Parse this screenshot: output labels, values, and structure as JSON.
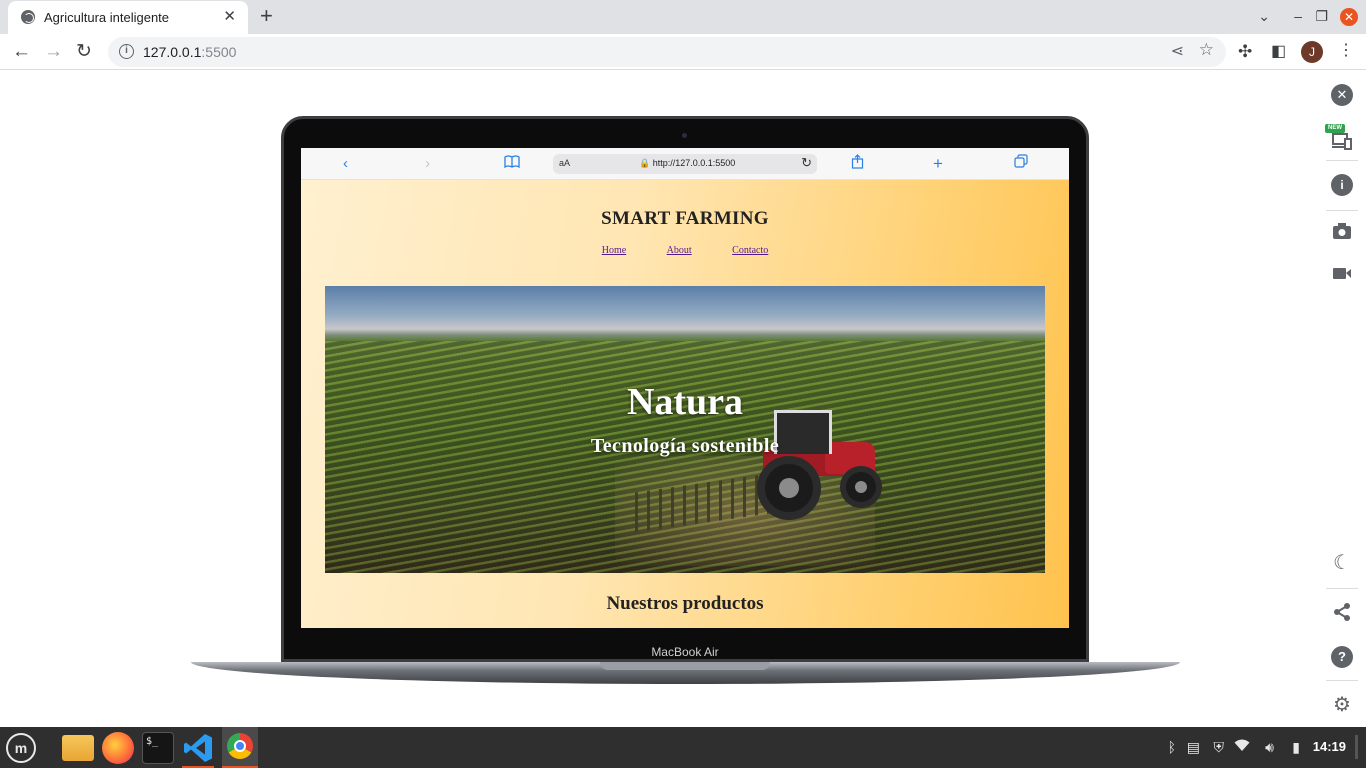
{
  "browser": {
    "tab": {
      "title": "Agricultura inteligente",
      "close_icon": "close-icon"
    },
    "window_controls": {
      "minimize": "–",
      "restore": "❐",
      "close": "✕",
      "tab_list": "⌄"
    },
    "toolbar": {
      "url_host": "127.0.0.1",
      "url_port": ":5500",
      "profile_initial": "J"
    }
  },
  "macbook": {
    "brand_label": "MacBook Air",
    "safari": {
      "aa_label": "aA",
      "url": "http://127.0.0.1:5500"
    }
  },
  "site": {
    "title": "SMART FARMING",
    "nav": [
      "Home",
      "About",
      "Contacto"
    ],
    "hero": {
      "title": "Natura",
      "subtitle": "Tecnología sostenible"
    },
    "products_heading": "Nuestros productos"
  },
  "side_panel": {
    "badge": "NEW"
  },
  "taskbar": {
    "terminal_label": "$_",
    "clock": "14:19"
  }
}
